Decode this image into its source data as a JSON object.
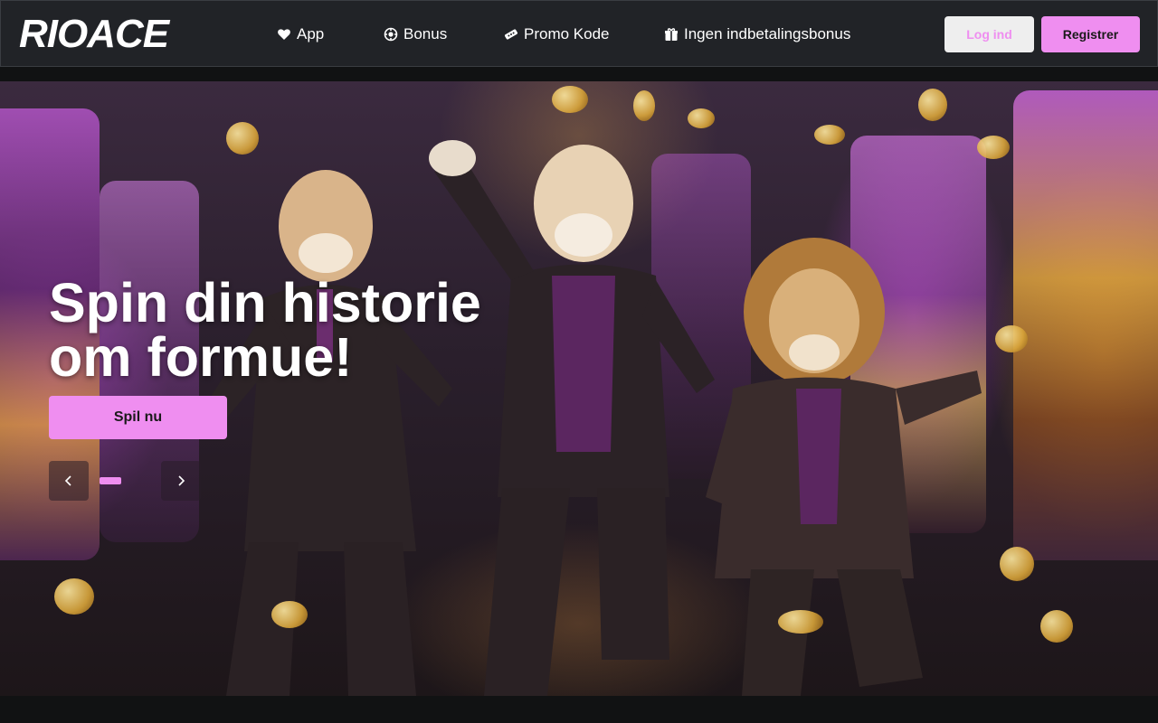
{
  "brand": {
    "logo_text": "RIOACE"
  },
  "nav": {
    "items": [
      {
        "label": "App",
        "icon": "heart-icon"
      },
      {
        "label": "Bonus",
        "icon": "chip-icon"
      },
      {
        "label": "Promo Kode",
        "icon": "coupon-icon"
      },
      {
        "label": "Ingen indbetalingsbonus",
        "icon": "gift-icon"
      }
    ]
  },
  "auth": {
    "login_label": "Log ind",
    "register_label": "Registrer"
  },
  "hero": {
    "title": "Spin din historie om formue!",
    "cta_label": "Spil nu",
    "slide_count": 1,
    "active_slide": 1
  },
  "colors": {
    "accent": "#ef8ef0",
    "header_bg": "#212327",
    "page_bg": "#111213"
  }
}
